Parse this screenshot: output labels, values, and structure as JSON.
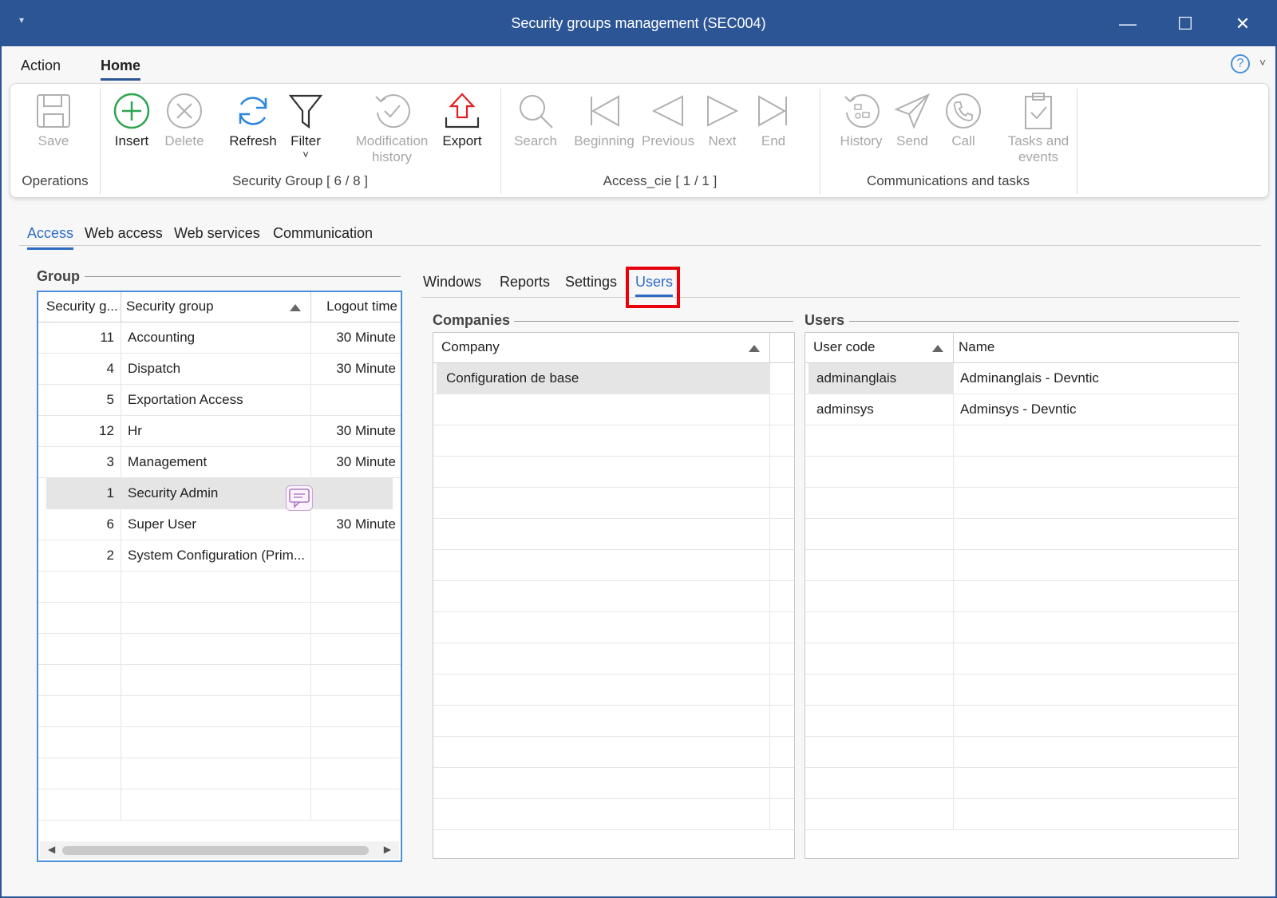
{
  "window": {
    "title": "Security groups management (SEC004)",
    "qa_glyph": "▾",
    "minimize": "—",
    "maximize": "☐",
    "close": "✕"
  },
  "menu": {
    "items": [
      "Action",
      "Home"
    ],
    "active": "Home",
    "help": "?",
    "help_chevron": "˅"
  },
  "ribbon": {
    "buttons": {
      "save": "Save",
      "insert": "Insert",
      "delete": "Delete",
      "refresh": "Refresh",
      "filter": "Filter",
      "filter_chevron": "˅",
      "modification_history_1": "Modification",
      "modification_history_2": "history",
      "export": "Export",
      "search": "Search",
      "beginning": "Beginning",
      "previous": "Previous",
      "next": "Next",
      "end": "End",
      "history": "History",
      "send": "Send",
      "call": "Call",
      "tasks_1": "Tasks and",
      "tasks_2": "events"
    },
    "groups": {
      "operations": "Operations",
      "security_group": "Security Group [ 6 / 8 ]",
      "access_cie": "Access_cie [ 1 / 1 ]",
      "communications": "Communications and tasks"
    }
  },
  "main_tabs": [
    "Access",
    "Web access",
    "Web services",
    "Communication"
  ],
  "group_section": {
    "title": "Group",
    "columns": [
      "Security g...",
      "Security group",
      "Logout time"
    ],
    "rows": [
      {
        "id": "11",
        "name": "Accounting",
        "logout": "30 Minute"
      },
      {
        "id": "4",
        "name": "Dispatch",
        "logout": "30 Minute"
      },
      {
        "id": "5",
        "name": "Exportation Access",
        "logout": ""
      },
      {
        "id": "12",
        "name": "Hr",
        "logout": "30 Minute"
      },
      {
        "id": "3",
        "name": "Management",
        "logout": "30 Minute"
      },
      {
        "id": "1",
        "name": "Security Admin",
        "logout": ""
      },
      {
        "id": "6",
        "name": "Super User",
        "logout": "30 Minute"
      },
      {
        "id": "2",
        "name": "System Configuration (Prim...",
        "logout": ""
      }
    ],
    "scroll_left": "◀",
    "scroll_right": "▶"
  },
  "sub_tabs": [
    "Windows",
    "Reports",
    "Settings",
    "Users"
  ],
  "companies": {
    "title": "Companies",
    "column": "Company",
    "rows": [
      "Configuration de base"
    ]
  },
  "users": {
    "title": "Users",
    "columns": [
      "User code",
      "Name"
    ],
    "rows": [
      {
        "code": "adminanglais",
        "name": "Adminanglais - Devntic"
      },
      {
        "code": "adminsys",
        "name": "Adminsys - Devntic"
      }
    ]
  }
}
